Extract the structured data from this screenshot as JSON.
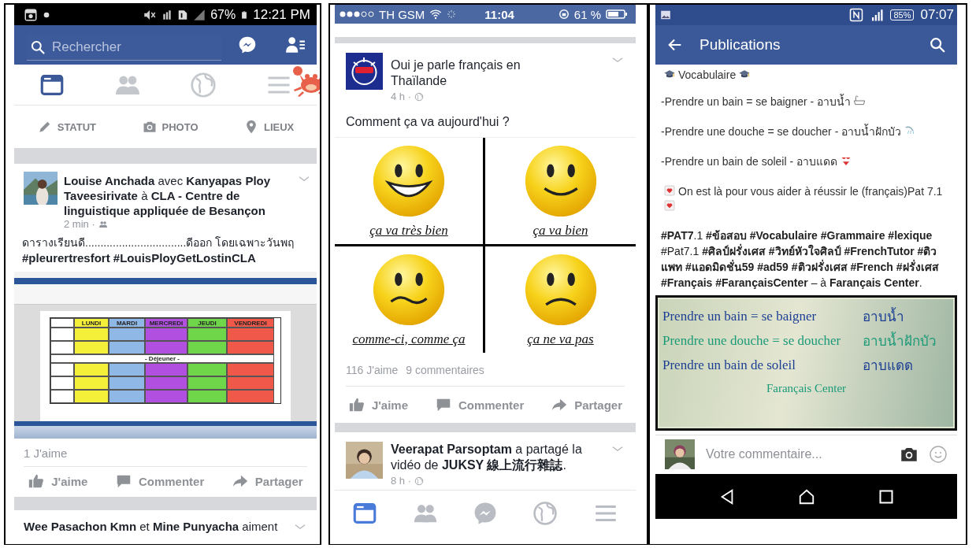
{
  "left_phone": {
    "status_bar": {
      "battery": "67%",
      "time": "12:21 PM"
    },
    "search": {
      "placeholder": "Rechercher"
    },
    "nav_tabs": [
      {
        "kind": "feed",
        "selected": true
      },
      {
        "kind": "friends",
        "selected": false
      },
      {
        "kind": "globe",
        "selected": false
      },
      {
        "kind": "menu",
        "selected": false
      }
    ],
    "composer_actions": [
      {
        "kind": "status",
        "label": "STATUT"
      },
      {
        "label": "PHOTO"
      },
      {
        "kind": "places",
        "label": "LIEUX"
      }
    ],
    "post": {
      "header": "**Louise Anchada** avec **Kanyapas Ploy Taveesirivate** à **CLA - Centre de linguistique appliquée de Besançon**",
      "time": "2 min ·",
      "text": "ดารางเรียนดี.................................ดีออก โดยเฉพาะวันพฤ",
      "hashtags": "#pleurertresfort #LouisPloyGetLostinCLA",
      "timetable": {
        "days": [
          {
            "label": "LUNDI",
            "color": "#f4f03a"
          },
          {
            "label": "MARDI",
            "color": "#8fb8e6"
          },
          {
            "label": "MERCREDI",
            "color": "#b04fe0"
          },
          {
            "label": "JEUDI",
            "color": "#6fd64a"
          },
          {
            "label": "VENDREDI",
            "color": "#f0584a"
          }
        ],
        "break_label": "- Déjeuner -"
      },
      "likes": "1 J'aime",
      "actions": [
        {
          "kind": "like",
          "label": "J'aime"
        },
        {
          "kind": "comment",
          "label": "Commenter"
        },
        {
          "kind": "share",
          "label": "Partager"
        }
      ]
    },
    "next_post": {
      "header": "**Wee Pasachon Kmn** et **Mine Punyacha** aiment"
    }
  },
  "middle_phone": {
    "status_bar": {
      "carrier": "TH GSM",
      "time": "11:04",
      "battery": "61 %"
    },
    "post": {
      "author": "Oui je parle français en Thaïlande",
      "time": "4 h ·",
      "text": "Comment ça va aujourd'hui ?",
      "moods": [
        {
          "kind": "laugh",
          "caption": "ça va très bien"
        },
        {
          "kind": "smile",
          "caption": "ça va bien"
        },
        {
          "kind": "meh",
          "caption": "comme-ci, comme ça"
        },
        {
          "kind": "sad",
          "caption": "ça ne va pas"
        }
      ],
      "likes": "116 J'aime",
      "comments": "9 commentaires",
      "actions": [
        {
          "kind": "like",
          "label": "J'aime"
        },
        {
          "kind": "comment",
          "label": "Commenter"
        },
        {
          "kind": "share",
          "label": "Partager"
        }
      ]
    },
    "next_post": {
      "header": "**Veerapat Parsoptam** a partagé la vidéo de **JUKSY 線上流行雜誌**.",
      "time": "8 h ·"
    },
    "bottom_nav": [
      {
        "kind": "feed",
        "selected": true
      },
      {
        "kind": "friends",
        "selected": false
      },
      {
        "kind": "messenger",
        "selected": false
      },
      {
        "kind": "globe",
        "selected": false
      },
      {
        "kind": "menu",
        "selected": false
      }
    ]
  },
  "right_phone": {
    "status_bar": {
      "battery": "85%",
      "time": "07:07"
    },
    "app_bar": {
      "title": "Publications"
    },
    "post_lines": [
      {
        "text": "Vocabulaire",
        "before": {
          "kind": "cap"
        },
        "after": {
          "kind": "cap"
        }
      },
      {
        "text": "-Prendre un bain = se baigner - อาบน้ำ",
        "after": {
          "kind": "bathtub"
        }
      },
      {
        "text": "-Prendre une douche = se doucher - อาบน้ำฝักบัว",
        "after": {
          "kind": "shower"
        }
      },
      {
        "text": "-Prendre un bain de soleil - อาบแดด",
        "after": {
          "kind": "bikini"
        }
      },
      {
        "text": "On est là pour vous aider à réussir le (français)Pat 7.1",
        "before": {
          "kind": "letter"
        },
        "after": {
          "kind": "letter"
        }
      }
    ],
    "hashtags": "**#PAT7**.1 **#ข้อสอบ #Vocabulaire #Grammaire #lexique** #Pat7.1 **#ศิลป์ฝรั่งเศส #วิทย์หัวใจศิลป์ #FrenchTutor #ติวแพท #แอดมิดชั่น59 #ad59 #ติวฝรั่งเศส #French #ฝรั่งเศส #Français #FarançaisCenter** – à **Farançais Center**.",
    "board": {
      "lines": [
        {
          "french": "Prendre un bain = se baigner",
          "thai": "อาบน้ำ",
          "color": "#1d3f93"
        },
        {
          "french": "Prendre une douche = se doucher",
          "thai": "อาบน้ำฝักบัว",
          "color": "#1b9a78"
        },
        {
          "french": "Prendre un bain de soleil",
          "thai": "อาบแดด",
          "color": "#1d3f93"
        }
      ],
      "signature": "Farançais Center"
    },
    "comment": {
      "placeholder": "Votre commentaire..."
    }
  }
}
